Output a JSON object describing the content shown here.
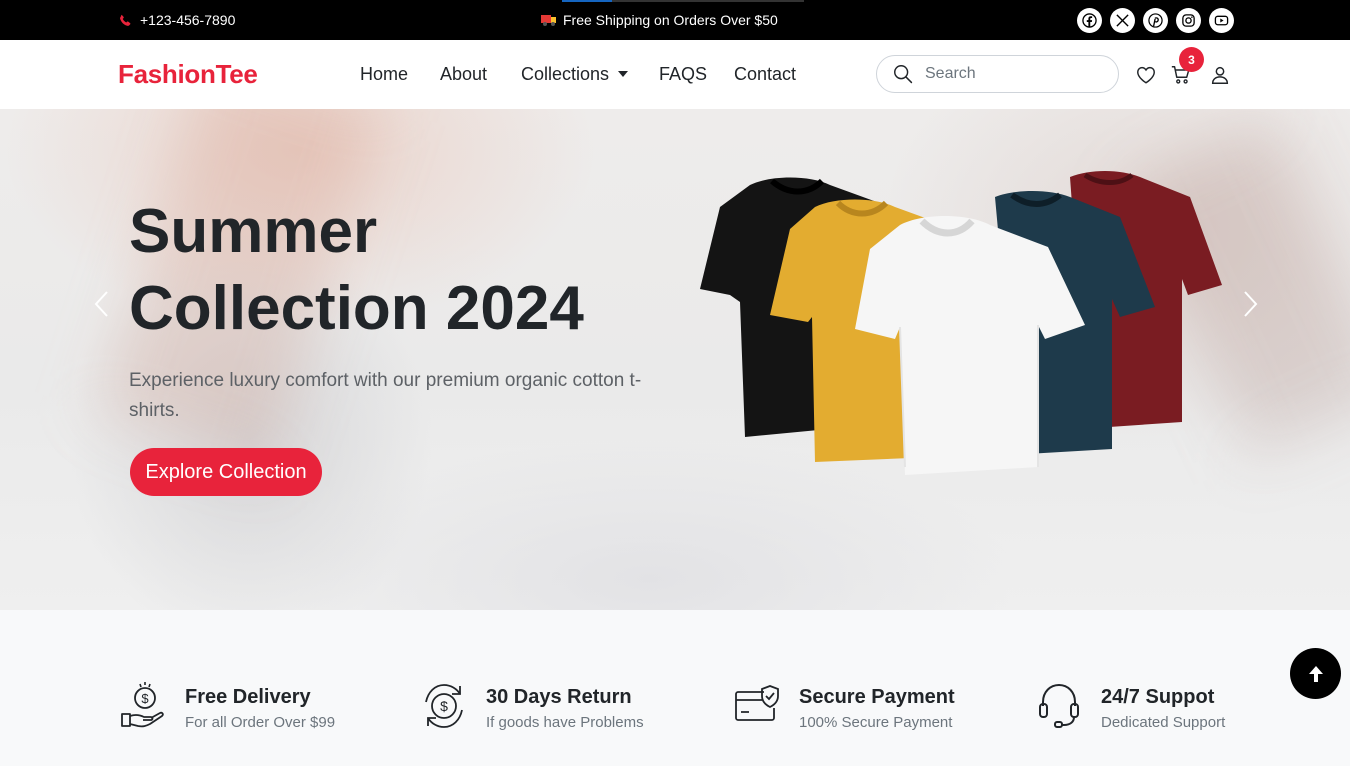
{
  "topbar": {
    "phone": "+123-456-7890",
    "shipping": "Free Shipping on Orders Over $50",
    "social": [
      {
        "icon": "facebook-icon"
      },
      {
        "icon": "x-icon"
      },
      {
        "icon": "pinterest-icon"
      },
      {
        "icon": "instagram-icon"
      },
      {
        "icon": "youtube-icon"
      }
    ]
  },
  "navbar": {
    "brand": "FashionTee",
    "links": [
      "Home",
      "About",
      "Collections",
      "FAQS",
      "Contact"
    ],
    "search_placeholder": "Search",
    "cart_count": "3"
  },
  "hero": {
    "title_line1": "Summer",
    "title_line2": "Collection 2024",
    "subtitle": "Experience luxury comfort with our premium organic cotton t-shirts.",
    "button": "Explore Collection"
  },
  "features": [
    {
      "title": "Free Delivery",
      "desc": "For all Order Over $99",
      "icon": "delivery-money-icon"
    },
    {
      "title": "30 Days Return",
      "desc": "If goods have Problems",
      "icon": "return-money-icon"
    },
    {
      "title": "Secure Payment",
      "desc": "100% Secure Payment",
      "icon": "secure-card-icon"
    },
    {
      "title": "24/7 Suppot",
      "desc": "Dedicated Support",
      "icon": "headset-icon"
    }
  ],
  "colors": {
    "accent": "#e8233b",
    "topbar": "#000000"
  }
}
